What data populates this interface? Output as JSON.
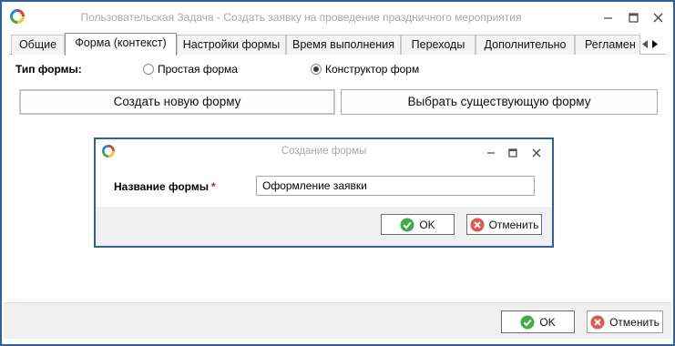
{
  "window": {
    "title": "Пользовательская Задача - Создать заявку на проведение праздничного мероприятия",
    "accent_color": "#2f5fa8"
  },
  "tabs": [
    {
      "label": "Общие",
      "active": false
    },
    {
      "label": "Форма (контекст)",
      "active": true
    },
    {
      "label": "Настройки формы",
      "active": false
    },
    {
      "label": "Время выполнения",
      "active": false
    },
    {
      "label": "Переходы",
      "active": false
    },
    {
      "label": "Дополнительно",
      "active": false
    },
    {
      "label": "Регламен",
      "active": false
    }
  ],
  "form_type": {
    "label": "Тип формы:",
    "options": [
      {
        "label": "Простая форма",
        "checked": false
      },
      {
        "label": "Конструктор форм",
        "checked": true
      }
    ]
  },
  "buttons": {
    "create_new": "Создать новую форму",
    "choose_existing": "Выбрать существующую форму"
  },
  "dialog": {
    "title": "Создание формы",
    "field_label": "Название формы",
    "required_mark": "*",
    "field_value": "Оформление заявки",
    "ok": "OK",
    "cancel": "Отменить"
  },
  "footer": {
    "ok": "OK",
    "cancel": "Отменить"
  },
  "icons": {
    "ok_icon": "green-check-circle",
    "cancel_icon": "red-x-circle"
  }
}
